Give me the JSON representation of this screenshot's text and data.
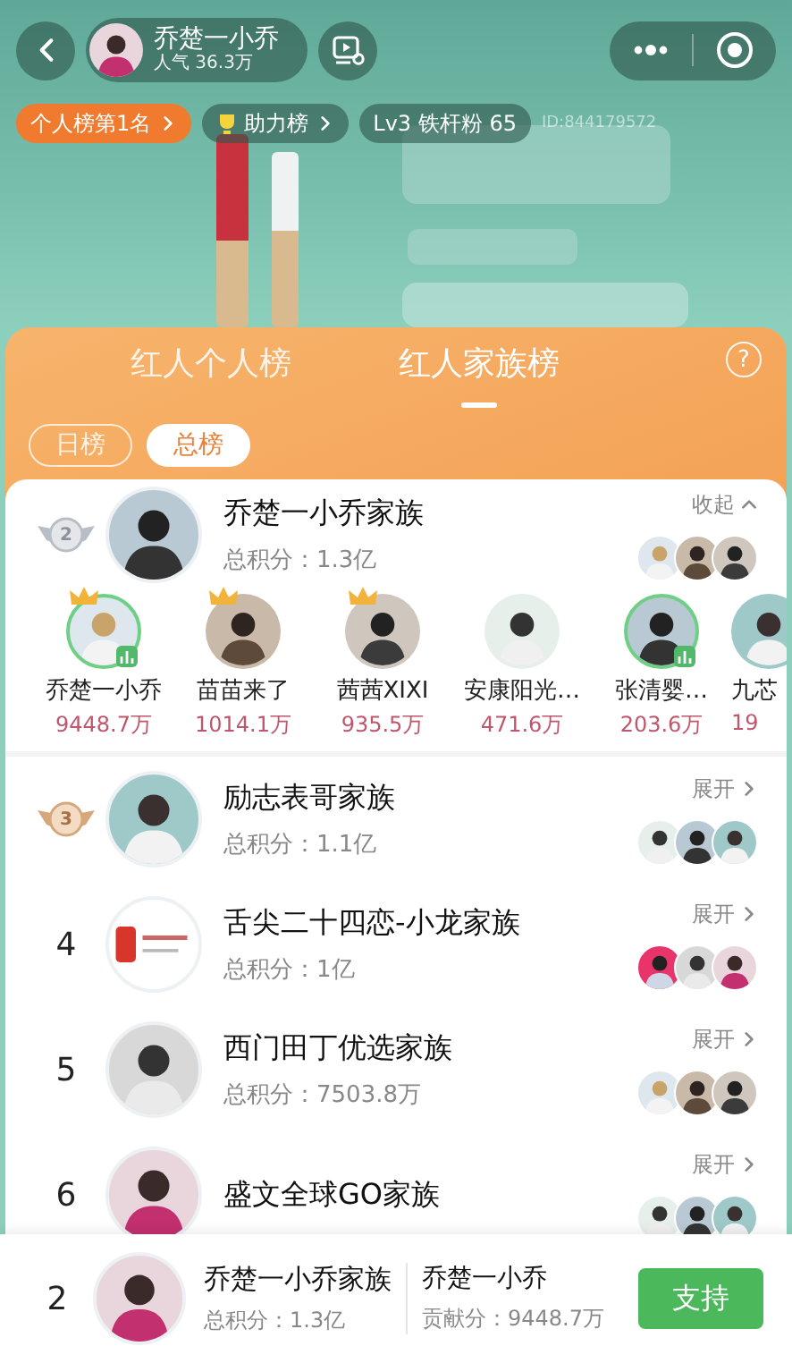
{
  "live_header": {
    "host_name": "乔楚一小乔",
    "popularity": "人气 36.3万",
    "tags": [
      {
        "kind": "rank",
        "label": "个人榜第1名"
      },
      {
        "kind": "support",
        "label": "助力榜"
      },
      {
        "kind": "fan",
        "label": "Lv3 铁杆粉 65"
      }
    ],
    "room_id": "ID:844179572"
  },
  "board": {
    "tabs": [
      {
        "label": "红人个人榜",
        "selected": false
      },
      {
        "label": "红人家族榜",
        "selected": true
      }
    ],
    "help": "?",
    "periods": [
      {
        "label": "日榜",
        "selected": false
      },
      {
        "label": "总榜",
        "selected": true
      }
    ],
    "families": [
      {
        "kind": "silver",
        "rank": "2",
        "avatar": {
          "kind": "person"
        },
        "name": "乔楚一小乔家族",
        "score": "总积分：1.3亿",
        "toggle": "收起",
        "expanded": true,
        "members": [
          {
            "name": "乔楚一小乔",
            "score": "9448.7万",
            "crown": true,
            "live": true,
            "partial": false
          },
          {
            "name": "苗苗来了",
            "score": "1014.1万",
            "crown": true,
            "live": false,
            "partial": false
          },
          {
            "name": "茜茜XIXI",
            "score": "935.5万",
            "crown": true,
            "live": false,
            "partial": false
          },
          {
            "name": "安康阳光…",
            "score": "471.6万",
            "crown": false,
            "live": false,
            "partial": false
          },
          {
            "name": "张清婴…",
            "score": "203.6万",
            "crown": false,
            "live": true,
            "partial": false
          },
          {
            "name": "九芯",
            "score": "19",
            "crown": false,
            "live": false,
            "partial": true
          }
        ]
      },
      {
        "kind": "bronze",
        "rank": "3",
        "avatar": {
          "kind": "person"
        },
        "name": "励志表哥家族",
        "score": "总积分：1.1亿",
        "toggle": "展开",
        "expanded": false
      },
      {
        "kind": "plain",
        "rank": "4",
        "avatar": {
          "kind": "logo"
        },
        "name": "舌尖二十四恋-小龙家族",
        "score": "总积分：1亿",
        "toggle": "展开",
        "expanded": false
      },
      {
        "kind": "plain",
        "rank": "5",
        "avatar": {
          "kind": "person"
        },
        "name": "西门田丁优选家族",
        "score": "总积分：7503.8万",
        "toggle": "展开",
        "expanded": false
      },
      {
        "kind": "plain",
        "rank": "6",
        "avatar": {
          "kind": "person"
        },
        "name": "盛文全球GO家族",
        "toggle": "展开",
        "expanded": false
      }
    ]
  },
  "my_family": {
    "rank": "2",
    "name": "乔楚一小乔家族",
    "score": "总积分：1.3亿",
    "member_name": "乔楚一小乔",
    "contribution": "贡献分：9448.7万",
    "button": "支持"
  }
}
